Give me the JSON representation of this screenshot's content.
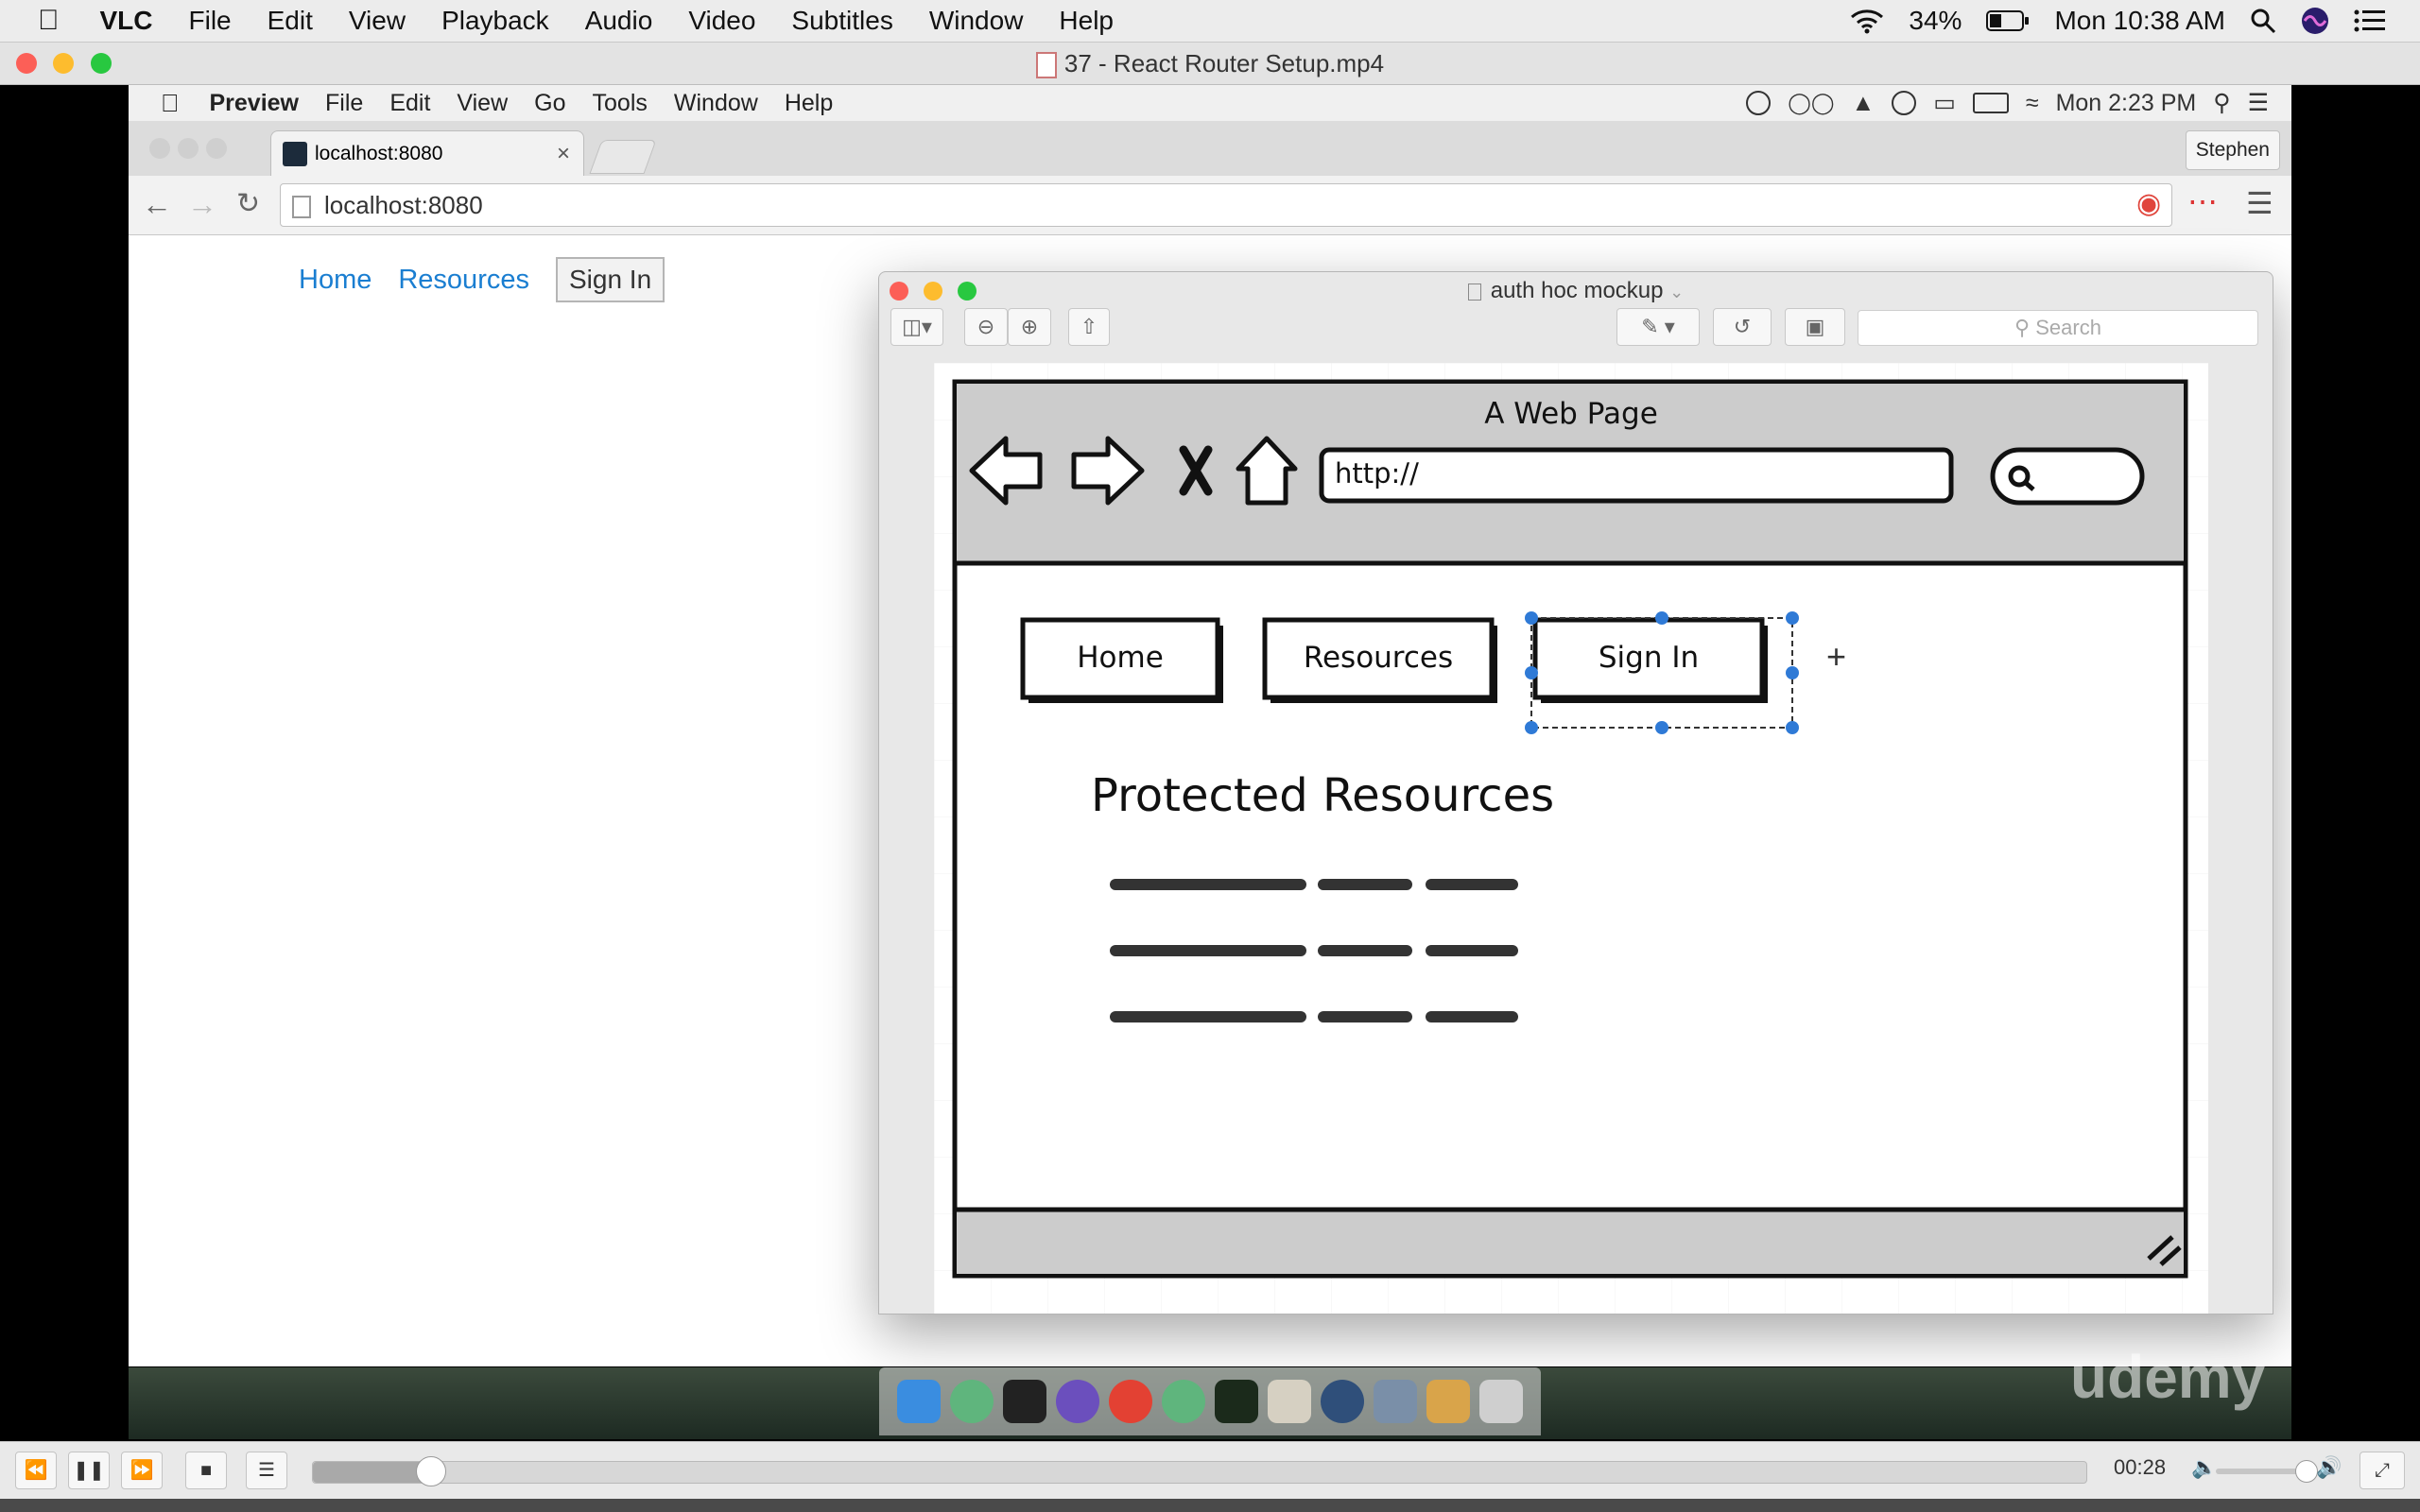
{
  "vlc_menubar": {
    "items": [
      "VLC",
      "File",
      "Edit",
      "View",
      "Playback",
      "Audio",
      "Video",
      "Subtitles",
      "Window",
      "Help"
    ],
    "battery": "34%",
    "clock": "Mon 10:38 AM",
    "icons": [
      "apple-icon",
      "wifi-icon",
      "battery-icon",
      "search-icon",
      "siri-icon",
      "list-icon"
    ]
  },
  "vlc_window": {
    "title": "37 - React Router Setup.mp4"
  },
  "inner_menubar": {
    "items": [
      "Preview",
      "File",
      "Edit",
      "View",
      "Go",
      "Tools",
      "Window",
      "Help"
    ],
    "clock": "Mon 2:23 PM"
  },
  "chrome": {
    "tab_title": "localhost:8080",
    "url": "localhost:8080",
    "profile": "Stephen"
  },
  "site": {
    "nav": {
      "home": "Home",
      "resources": "Resources",
      "sign_in": "Sign In"
    }
  },
  "preview": {
    "title": "auth hoc mockup",
    "search_placeholder": "Search"
  },
  "mockup": {
    "page_title": "A Web Page",
    "url": "http://",
    "buttons": {
      "home": "Home",
      "resources": "Resources",
      "sign_in": "Sign In"
    },
    "add_symbol": "+",
    "heading": "Protected Resources"
  },
  "watermark": "udemy",
  "playback": {
    "time": "00:28",
    "progress": 0.066,
    "volume": 0.93
  },
  "colors": {
    "link": "#1a7ed1",
    "selection": "#2f7ad6",
    "traffic_red": "#fc5f57",
    "traffic_yellow": "#fdbc2e",
    "traffic_green": "#28c840"
  }
}
